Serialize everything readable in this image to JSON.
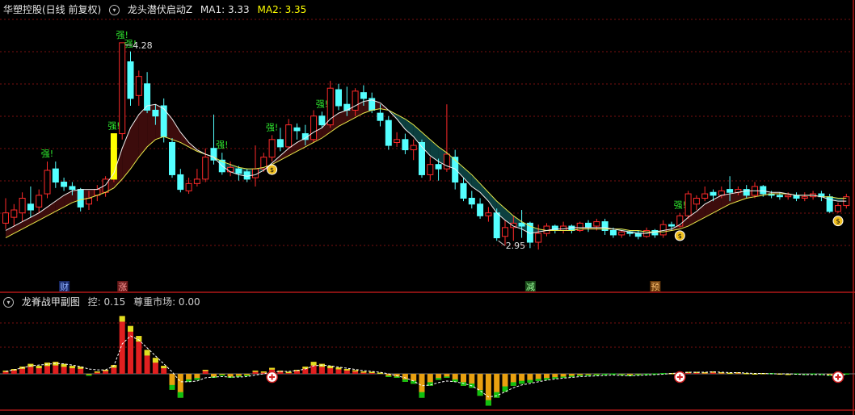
{
  "main_header": {
    "stock_title": "华塑控股(日线 前复权)",
    "indicator_name": "龙头潜伏启动Z",
    "ma1": "MA1: 3.33",
    "ma2": "MA2: 3.35",
    "toggle_icon": "circle-chevron-icon"
  },
  "sub_header": {
    "indicator_name": "龙脊战甲副图",
    "control": "控: 0.15",
    "respect_market": "尊重市场: 0.00",
    "toggle_icon": "circle-chevron-icon"
  },
  "annotations": {
    "high_price": "4.28",
    "low_price": "2.95",
    "strong": "强!",
    "markers": [
      "财",
      "涨",
      "减",
      "预"
    ]
  },
  "colors": {
    "up": "#ff2a2a",
    "down": "#54ffff",
    "ma_white": "#f0f0f0",
    "ma_yellow": "#e8e84a",
    "band_up": "#3c0c0c",
    "band_down": "#0c3f3f",
    "grid": "#7a1010",
    "highlight_bar": "#ffff00",
    "pos_bar": "#e02020",
    "pos_cap": "#e0e020",
    "neg_bar": "#e8a010",
    "neg_cap": "#10c010"
  },
  "chart_data": [
    {
      "type": "candlestick",
      "title": "龙头潜伏启动Z",
      "ylim": [
        2.7,
        4.45
      ],
      "candles": [
        [
          3.05,
          3.12,
          3.01,
          3.22
        ],
        [
          3.09,
          3.14,
          3.03,
          3.18
        ],
        [
          3.12,
          3.22,
          3.06,
          3.26
        ],
        [
          3.18,
          3.14,
          3.09,
          3.3
        ],
        [
          3.16,
          3.24,
          3.12,
          3.28
        ],
        [
          3.25,
          3.41,
          3.22,
          3.47
        ],
        [
          3.42,
          3.33,
          3.29,
          3.47
        ],
        [
          3.33,
          3.3,
          3.27,
          3.36
        ],
        [
          3.3,
          3.28,
          3.24,
          3.33
        ],
        [
          3.28,
          3.16,
          3.13,
          3.29
        ],
        [
          3.18,
          3.22,
          3.14,
          3.27
        ],
        [
          3.24,
          3.28,
          3.2,
          3.31
        ],
        [
          3.26,
          3.35,
          3.23,
          3.37
        ],
        [
          3.35,
          3.66,
          3.33,
          3.66
        ],
        [
          3.66,
          4.28,
          3.62,
          4.28
        ],
        [
          4.15,
          3.9,
          3.85,
          4.22
        ],
        [
          3.92,
          4.05,
          3.85,
          4.09
        ],
        [
          4.0,
          3.82,
          3.8,
          4.08
        ],
        [
          3.82,
          3.78,
          3.72,
          3.86
        ],
        [
          3.85,
          3.64,
          3.6,
          3.9
        ],
        [
          3.6,
          3.38,
          3.36,
          3.63
        ],
        [
          3.38,
          3.28,
          3.26,
          3.42
        ],
        [
          3.27,
          3.32,
          3.25,
          3.36
        ],
        [
          3.32,
          3.35,
          3.3,
          3.42
        ],
        [
          3.35,
          3.5,
          3.33,
          3.56
        ],
        [
          3.56,
          3.48,
          3.45,
          3.79
        ],
        [
          3.48,
          3.4,
          3.38,
          3.53
        ],
        [
          3.4,
          3.43,
          3.37,
          3.47
        ],
        [
          3.42,
          3.39,
          3.34,
          3.44
        ],
        [
          3.4,
          3.35,
          3.33,
          3.42
        ],
        [
          3.36,
          3.42,
          3.3,
          3.58
        ],
        [
          3.42,
          3.5,
          3.4,
          3.53
        ],
        [
          3.5,
          3.62,
          3.47,
          3.65
        ],
        [
          3.62,
          3.57,
          3.54,
          3.7
        ],
        [
          3.57,
          3.72,
          3.56,
          3.76
        ],
        [
          3.7,
          3.68,
          3.62,
          3.73
        ],
        [
          3.66,
          3.62,
          3.58,
          3.72
        ],
        [
          3.62,
          3.78,
          3.6,
          3.82
        ],
        [
          3.78,
          3.72,
          3.7,
          3.81
        ],
        [
          3.72,
          3.97,
          3.7,
          4.02
        ],
        [
          3.96,
          3.85,
          3.82,
          4.0
        ],
        [
          3.86,
          3.82,
          3.78,
          3.98
        ],
        [
          3.82,
          3.95,
          3.78,
          3.97
        ],
        [
          3.94,
          3.9,
          3.85,
          3.99
        ],
        [
          3.9,
          3.82,
          3.8,
          3.94
        ],
        [
          3.8,
          3.75,
          3.71,
          3.86
        ],
        [
          3.75,
          3.58,
          3.55,
          3.78
        ],
        [
          3.6,
          3.62,
          3.57,
          3.67
        ],
        [
          3.62,
          3.55,
          3.52,
          3.66
        ],
        [
          3.55,
          3.58,
          3.48,
          3.62
        ],
        [
          3.6,
          3.38,
          3.36,
          3.62
        ],
        [
          3.38,
          3.45,
          3.34,
          3.5
        ],
        [
          3.45,
          3.42,
          3.34,
          3.49
        ],
        [
          3.42,
          3.52,
          3.4,
          3.86
        ],
        [
          3.5,
          3.33,
          3.28,
          3.55
        ],
        [
          3.32,
          3.22,
          3.2,
          3.36
        ],
        [
          3.22,
          3.18,
          3.15,
          3.27
        ],
        [
          3.18,
          3.1,
          3.08,
          3.22
        ],
        [
          3.1,
          3.12,
          3.06,
          3.16
        ],
        [
          3.12,
          2.95,
          2.93,
          3.15
        ],
        [
          2.96,
          3.02,
          2.9,
          3.07
        ],
        [
          3.02,
          3.05,
          2.93,
          3.1
        ],
        [
          3.05,
          3.03,
          2.95,
          3.14
        ],
        [
          3.05,
          2.92,
          2.88,
          3.06
        ],
        [
          2.92,
          2.98,
          2.87,
          3.04
        ],
        [
          2.98,
          3.03,
          2.96,
          3.05
        ],
        [
          3.03,
          3.0,
          2.98,
          3.04
        ],
        [
          3.0,
          3.03,
          2.98,
          3.06
        ],
        [
          3.03,
          3.0,
          2.98,
          3.04
        ],
        [
          3.0,
          3.05,
          2.99,
          3.06
        ],
        [
          3.05,
          3.02,
          2.99,
          3.07
        ],
        [
          3.03,
          3.06,
          3.0,
          3.08
        ],
        [
          3.06,
          3.0,
          2.97,
          3.08
        ],
        [
          3.0,
          2.97,
          2.95,
          3.02
        ],
        [
          2.97,
          2.99,
          2.95,
          3.0
        ],
        [
          2.99,
          2.98,
          2.96,
          3.0
        ],
        [
          2.98,
          2.96,
          2.94,
          3.0
        ],
        [
          2.96,
          3.0,
          2.95,
          3.02
        ],
        [
          3.0,
          2.97,
          2.95,
          3.01
        ],
        [
          2.97,
          3.04,
          2.95,
          3.07
        ],
        [
          3.04,
          3.03,
          3.0,
          3.06
        ],
        [
          3.03,
          3.1,
          3.02,
          3.12
        ],
        [
          3.1,
          3.25,
          3.08,
          3.27
        ],
        [
          3.18,
          3.22,
          3.14,
          3.24
        ],
        [
          3.22,
          3.25,
          3.2,
          3.3
        ],
        [
          3.26,
          3.24,
          3.2,
          3.28
        ],
        [
          3.24,
          3.27,
          3.22,
          3.3
        ],
        [
          3.28,
          3.26,
          3.2,
          3.37
        ],
        [
          3.26,
          3.28,
          3.24,
          3.3
        ],
        [
          3.28,
          3.24,
          3.22,
          3.31
        ],
        [
          3.24,
          3.3,
          3.22,
          3.33
        ],
        [
          3.3,
          3.25,
          3.23,
          3.31
        ],
        [
          3.25,
          3.24,
          3.22,
          3.27
        ],
        [
          3.24,
          3.23,
          3.21,
          3.26
        ],
        [
          3.23,
          3.24,
          3.21,
          3.26
        ],
        [
          3.24,
          3.22,
          3.2,
          3.26
        ],
        [
          3.22,
          3.23,
          3.2,
          3.26
        ],
        [
          3.23,
          3.25,
          3.21,
          3.27
        ],
        [
          3.25,
          3.23,
          3.2,
          3.27
        ],
        [
          3.23,
          3.13,
          3.12,
          3.25
        ],
        [
          3.13,
          3.17,
          3.12,
          3.19
        ],
        [
          3.17,
          3.23,
          3.15,
          3.25
        ]
      ],
      "ma1": [
        3.0,
        3.03,
        3.06,
        3.09,
        3.12,
        3.16,
        3.2,
        3.24,
        3.27,
        3.28,
        3.28,
        3.28,
        3.31,
        3.39,
        3.56,
        3.7,
        3.79,
        3.85,
        3.86,
        3.83,
        3.76,
        3.67,
        3.6,
        3.55,
        3.52,
        3.5,
        3.44,
        3.4,
        3.38,
        3.37,
        3.38,
        3.41,
        3.46,
        3.51,
        3.56,
        3.6,
        3.63,
        3.67,
        3.7,
        3.76,
        3.8,
        3.82,
        3.85,
        3.88,
        3.89,
        3.87,
        3.82,
        3.76,
        3.69,
        3.64,
        3.57,
        3.51,
        3.47,
        3.44,
        3.42,
        3.36,
        3.3,
        3.26,
        3.2,
        3.12,
        3.07,
        3.03,
        3.01,
        2.98,
        2.99,
        3.0,
        3.01,
        3.01,
        3.02,
        3.02,
        3.02,
        3.02,
        3.02,
        3.01,
        3.0,
        2.99,
        2.98,
        2.98,
        2.99,
        3.0,
        3.01,
        3.04,
        3.09,
        3.13,
        3.18,
        3.21,
        3.24,
        3.25,
        3.26,
        3.27,
        3.27,
        3.27,
        3.26,
        3.26,
        3.25,
        3.24,
        3.24,
        3.24,
        3.23,
        3.21,
        3.2,
        3.2
      ],
      "ma2": [
        2.95,
        2.98,
        3.01,
        3.04,
        3.07,
        3.1,
        3.13,
        3.16,
        3.19,
        3.21,
        3.22,
        3.24,
        3.26,
        3.29,
        3.35,
        3.42,
        3.5,
        3.57,
        3.62,
        3.64,
        3.62,
        3.6,
        3.57,
        3.54,
        3.52,
        3.5,
        3.47,
        3.45,
        3.43,
        3.42,
        3.42,
        3.43,
        3.45,
        3.48,
        3.51,
        3.54,
        3.57,
        3.6,
        3.63,
        3.67,
        3.71,
        3.74,
        3.77,
        3.8,
        3.82,
        3.83,
        3.82,
        3.79,
        3.76,
        3.72,
        3.67,
        3.62,
        3.57,
        3.53,
        3.48,
        3.43,
        3.38,
        3.32,
        3.26,
        3.2,
        3.15,
        3.1,
        3.06,
        3.03,
        3.01,
        3.0,
        3.0,
        3.0,
        3.0,
        3.01,
        3.01,
        3.01,
        3.01,
        3.01,
        3.01,
        3.0,
        3.0,
        2.99,
        2.99,
        2.99,
        3.0,
        3.01,
        3.03,
        3.06,
        3.09,
        3.12,
        3.15,
        3.18,
        3.2,
        3.22,
        3.23,
        3.24,
        3.25,
        3.25,
        3.25,
        3.24,
        3.24,
        3.24,
        3.23,
        3.23,
        3.22,
        3.22
      ],
      "strong_at": [
        5,
        13,
        14,
        15,
        26,
        32,
        38,
        81
      ],
      "money_bag_at": [
        32,
        81,
        100
      ],
      "marker_at": [
        7,
        14,
        63,
        78
      ]
    },
    {
      "type": "bar",
      "title": "龙脊战甲副图",
      "ylim": [
        -0.95,
        1.6
      ],
      "values": [
        0.08,
        0.12,
        0.18,
        0.25,
        0.2,
        0.28,
        0.3,
        0.25,
        0.2,
        0.18,
        -0.05,
        0.06,
        0.1,
        0.22,
        1.45,
        1.2,
        0.95,
        0.6,
        0.4,
        0.2,
        -0.4,
        -0.6,
        -0.2,
        -0.15,
        0.1,
        -0.1,
        -0.05,
        -0.1,
        -0.08,
        -0.06,
        0.08,
        0.06,
        0.15,
        0.08,
        0.05,
        0.1,
        0.18,
        0.3,
        0.25,
        0.2,
        0.16,
        0.12,
        0.09,
        0.06,
        0.05,
        0.03,
        -0.08,
        -0.1,
        -0.2,
        -0.25,
        -0.6,
        -0.3,
        -0.15,
        -0.1,
        -0.2,
        -0.3,
        -0.35,
        -0.55,
        -0.8,
        -0.6,
        -0.45,
        -0.3,
        -0.25,
        -0.22,
        -0.18,
        -0.15,
        -0.12,
        -0.1,
        -0.08,
        -0.06,
        -0.05,
        -0.04,
        -0.03,
        -0.02,
        -0.04,
        -0.06,
        -0.04,
        -0.03,
        -0.02,
        -0.01,
        0.02,
        0.03,
        0.05,
        0.05,
        0.04,
        0.06,
        0.04,
        0.03,
        0.04,
        0.02,
        0.01,
        0.02,
        -0.01,
        0.01,
        0.0,
        -0.02,
        -0.03,
        -0.02,
        -0.03,
        -0.05,
        -0.03,
        -0.02
      ],
      "trend": [
        0.06,
        0.1,
        0.15,
        0.2,
        0.22,
        0.24,
        0.26,
        0.25,
        0.22,
        0.18,
        0.12,
        0.1,
        0.1,
        0.2,
        0.75,
        0.95,
        0.85,
        0.65,
        0.45,
        0.25,
        0.05,
        -0.2,
        -0.2,
        -0.18,
        -0.1,
        -0.08,
        -0.07,
        -0.08,
        -0.08,
        -0.07,
        -0.03,
        0.0,
        0.05,
        0.06,
        0.06,
        0.08,
        0.12,
        0.2,
        0.22,
        0.2,
        0.17,
        0.14,
        0.11,
        0.08,
        0.06,
        0.04,
        0.0,
        -0.05,
        -0.1,
        -0.18,
        -0.3,
        -0.28,
        -0.22,
        -0.18,
        -0.2,
        -0.24,
        -0.3,
        -0.42,
        -0.58,
        -0.55,
        -0.45,
        -0.35,
        -0.28,
        -0.24,
        -0.2,
        -0.16,
        -0.13,
        -0.11,
        -0.09,
        -0.07,
        -0.06,
        -0.05,
        -0.04,
        -0.03,
        -0.04,
        -0.05,
        -0.04,
        -0.03,
        -0.02,
        -0.01,
        0.01,
        0.02,
        0.04,
        0.04,
        0.04,
        0.05,
        0.04,
        0.03,
        0.03,
        0.02,
        0.01,
        0.01,
        0.0,
        0.0,
        0.0,
        -0.01,
        -0.02,
        -0.02,
        -0.02,
        -0.03,
        -0.03,
        -0.02
      ],
      "plus_at": [
        32,
        81,
        100
      ]
    }
  ]
}
